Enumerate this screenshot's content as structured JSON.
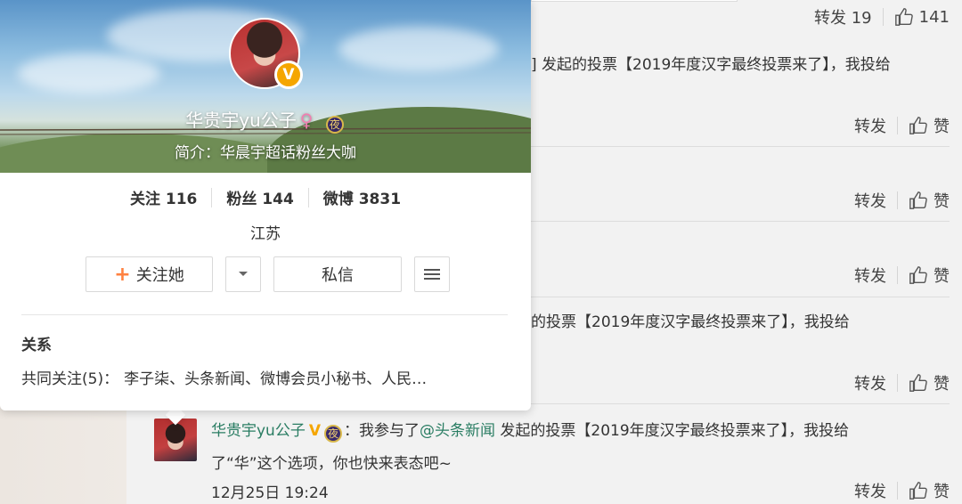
{
  "feed": {
    "posts": [
      {
        "repost_label": "转发 19",
        "like_label": "141",
        "text_line1": "] 发起的投票【2019年度汉字最终投票来了】，我投给",
        "repost": "转发",
        "like": "赞"
      },
      {
        "repost": "转发",
        "like": "赞"
      },
      {
        "repost": "转发",
        "like": "赞"
      },
      {
        "text_line1": "的投票【2019年度汉字最终投票来了】，我投给",
        "repost": "转发",
        "like": "赞"
      },
      {
        "author": "华贵宇yu公子",
        "verified_mark": "V",
        "level_badge": "夜",
        "colon": "：我参与了",
        "mention": "@头条新闻",
        "text_rest": " 发起的投票【2019年度汉字最终投票来了】，我投给",
        "text_line2": "了“华”这个选项，你也快来表态吧~",
        "timestamp": "12月25日 19:24",
        "repost": "转发",
        "like": "赞"
      }
    ]
  },
  "profile_card": {
    "name": "华贵宇yu公子",
    "gender_symbol": "♀",
    "level_badge": "夜",
    "verified_mark": "V",
    "bio": "简介：华晨宇超话粉丝大咖",
    "stats": {
      "following_label": "关注",
      "following_count": "116",
      "followers_label": "粉丝",
      "followers_count": "144",
      "posts_label": "微博",
      "posts_count": "3831"
    },
    "location": "江苏",
    "follow_button": "关注她",
    "follow_plus": "+",
    "message_button": "私信",
    "relation_title": "关系",
    "mutual_label": "共同关注(5)：",
    "mutual_names": "李子柒、头条新闻、微博会员小秘书、人民…"
  },
  "colors": {
    "link_green": "#2a7d63",
    "vip_orange": "#f5a600",
    "plus_orange": "#ff8140"
  }
}
